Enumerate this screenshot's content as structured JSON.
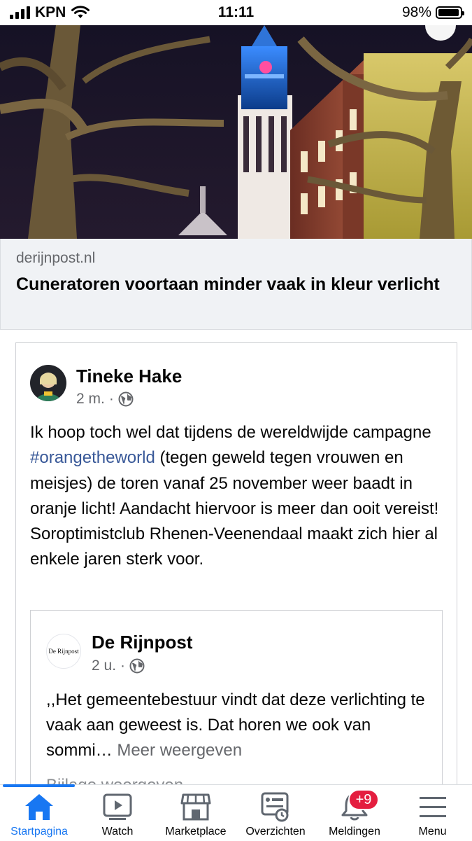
{
  "status_bar": {
    "carrier": "KPN",
    "time": "11:11",
    "battery": "98%",
    "battery_level": 0.98
  },
  "link_preview": {
    "domain": "derijnpost.nl",
    "title": "Cuneratoren voortaan minder vaak in kleur verlicht"
  },
  "comment": {
    "author": "Tineke Hake",
    "time": "2 m.",
    "audience_icon": "globe-icon",
    "text_before": "Ik hoop toch wel dat tijdens de wereldwijde campagne ",
    "hashtag": "#orangetheworld",
    "text_after": " (tegen geweld tegen vrouwen en meisjes) de toren vanaf 25 november weer baadt in oranje licht! Aandacht hiervoor is meer dan ooit vereist! Soroptimistclub Rhenen-Veenendaal maakt zich hier al enkele jaren sterk voor."
  },
  "shared_post": {
    "author": "De Rijnpost",
    "avatar_text": "De Rijnpost",
    "time": "2 u.",
    "text": ",,Het gemeentebestuur vindt dat deze verlichting te vaak aan geweest is. Dat horen we ook van sommi…",
    "see_more": "Meer weergeven",
    "cut_line": "Bijlage weergeven"
  },
  "tabbar": {
    "tabs": [
      {
        "label": "Startpagina",
        "icon": "home-icon",
        "active": true
      },
      {
        "label": "Watch",
        "icon": "video-icon"
      },
      {
        "label": "Marketplace",
        "icon": "store-icon"
      },
      {
        "label": "Overzichten",
        "icon": "feeds-icon"
      },
      {
        "label": "Meldingen",
        "icon": "bell-icon",
        "badge": "+9"
      },
      {
        "label": "Menu",
        "icon": "menu-icon"
      }
    ]
  },
  "colors": {
    "accent": "#1877f2",
    "badge": "#e41e3f",
    "link": "#385898",
    "secondary_text": "#65676b"
  }
}
